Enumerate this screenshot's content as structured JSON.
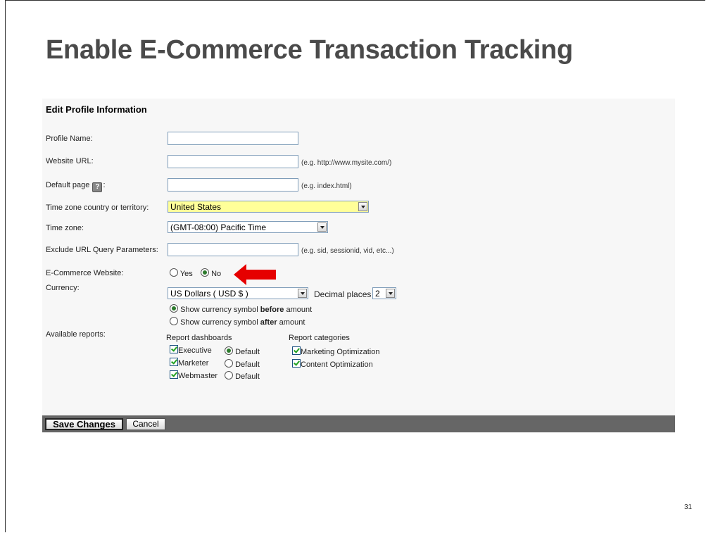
{
  "slide": {
    "title": "Enable E-Commerce Transaction Tracking",
    "page_number": "31"
  },
  "form": {
    "section_title": "Edit Profile Information",
    "profile_name": {
      "label": "Profile Name:",
      "value": ""
    },
    "website_url": {
      "label": "Website URL:",
      "value": "",
      "hint": "(e.g. http://www.mysite.com/)"
    },
    "default_page": {
      "label_before": "Default page",
      "label_after": ":",
      "help_icon": "question-help-icon",
      "value": "",
      "hint": "(e.g. index.html)"
    },
    "tz_country": {
      "label": "Time zone country or territory:",
      "value": "United States"
    },
    "time_zone": {
      "label": "Time zone:",
      "value": "(GMT-08:00) Pacific Time"
    },
    "exclude_params": {
      "label": "Exclude URL Query Parameters:",
      "value": "",
      "hint": "(e.g. sid, sessionid, vid, etc...)"
    },
    "ecommerce": {
      "label": "E-Commerce Website:",
      "yes": "Yes",
      "no": "No",
      "selected": "No"
    },
    "currency": {
      "label": "Currency:",
      "value": "US Dollars ( USD $ )",
      "decimal_label": "Decimal places",
      "decimal_value": "2",
      "symbol_before_pre": "Show currency symbol ",
      "symbol_before_bold": "before",
      "symbol_before_post": " amount",
      "symbol_after_pre": "Show currency symbol ",
      "symbol_after_bold": "after",
      "symbol_after_post": " amount",
      "symbol_selected": "before"
    },
    "reports": {
      "label": "Available reports:",
      "dashboards_title": "Report dashboards",
      "categories_title": "Report categories",
      "dashboards": [
        {
          "name": "Executive",
          "checked": true,
          "default_label": "Default",
          "is_default": true
        },
        {
          "name": "Marketer",
          "checked": true,
          "default_label": "Default",
          "is_default": false
        },
        {
          "name": "Webmaster",
          "checked": true,
          "default_label": "Default",
          "is_default": false
        }
      ],
      "categories": [
        {
          "name": "Marketing Optimization",
          "checked": true
        },
        {
          "name": "Content Optimization",
          "checked": true
        }
      ]
    },
    "buttons": {
      "save": "Save Changes",
      "cancel": "Cancel"
    }
  },
  "colors": {
    "highlight_select": "#ffff99",
    "arrow": "#e60000",
    "footer_bar": "#666666",
    "panel_bg": "#f7f7f7"
  }
}
